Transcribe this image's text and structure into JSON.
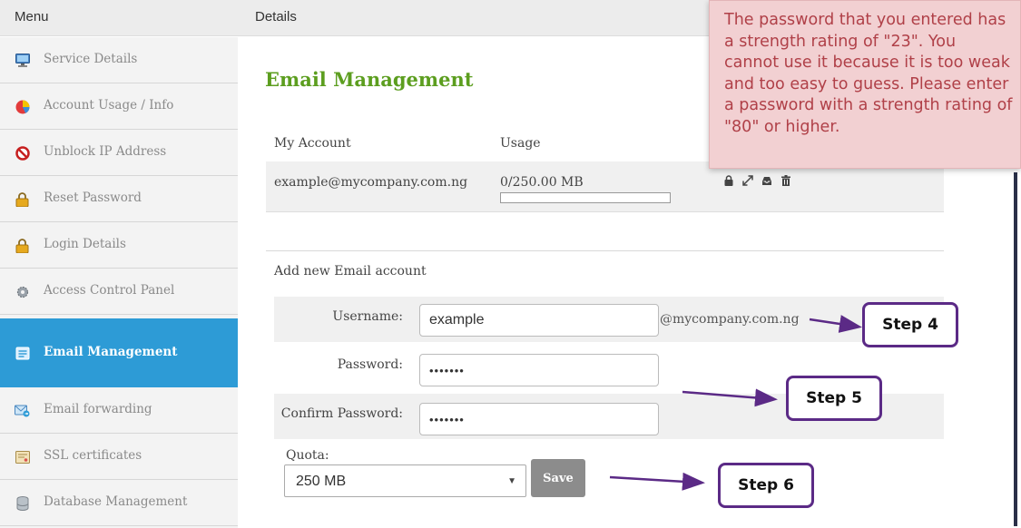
{
  "header": {
    "menu_title": "Menu",
    "details_title": "Details"
  },
  "sidebar": {
    "items": [
      {
        "label": "Service Details",
        "icon": "monitor-icon",
        "active": false
      },
      {
        "label": "Account Usage / Info",
        "icon": "pie-chart-icon",
        "active": false
      },
      {
        "label": "Unblock IP Address",
        "icon": "block-icon",
        "active": false
      },
      {
        "label": "Reset Password",
        "icon": "lock-icon",
        "active": false
      },
      {
        "label": "Login Details",
        "icon": "lock-icon",
        "active": false
      },
      {
        "label": "Access Control Panel",
        "icon": "gear-icon",
        "active": false
      },
      {
        "label": "Email Management",
        "icon": "email-icon",
        "active": true
      },
      {
        "label": "Email forwarding",
        "icon": "email-forward-icon",
        "active": false
      },
      {
        "label": "SSL certificates",
        "icon": "certificate-icon",
        "active": false
      },
      {
        "label": "Database Management",
        "icon": "database-icon",
        "active": false
      }
    ]
  },
  "main": {
    "title": "Email Management",
    "table": {
      "headers": {
        "account": "My Account",
        "usage": "Usage"
      },
      "rows": [
        {
          "account": "example@mycompany.com.ng",
          "usage": "0/250.00 MB",
          "usage_fraction": 0
        }
      ],
      "actions": [
        "lock-icon",
        "expand-icon",
        "inbox-icon",
        "trash-icon"
      ]
    },
    "form": {
      "title": "Add new Email account",
      "username_label": "Username:",
      "username_value": "example",
      "domain_suffix": "@mycompany.com.ng",
      "password_label": "Password:",
      "password_value": "•••••••",
      "confirm_label": "Confirm Password:",
      "confirm_value": "•••••••",
      "quota_label": "Quota:",
      "quota_value": "250 MB",
      "save_label": "Save"
    }
  },
  "steps": {
    "step4": "Step 4",
    "step5": "Step 5",
    "step6": "Step 6"
  },
  "warning": {
    "text": "The password that you entered has a strength rating of \"23\". You cannot use it because it is too weak and too easy to guess. Please enter a password with a strength rating of \"80\" or higher."
  },
  "colors": {
    "accent_blue": "#2d9bd6",
    "title_green": "#5c9e1f",
    "callout_purple": "#5b2a86",
    "warning_bg": "#f2d0d2",
    "warning_text": "#b04048"
  }
}
